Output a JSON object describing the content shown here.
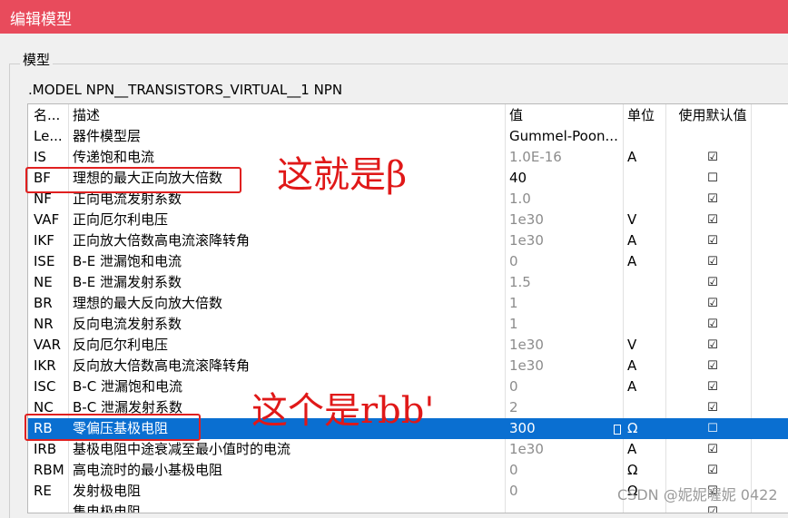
{
  "window": {
    "title": "编辑模型"
  },
  "group": {
    "label": "模型"
  },
  "model_line": ".MODEL NPN__TRANSISTORS_VIRTUAL__1 NPN",
  "table": {
    "headers": {
      "name": "名...",
      "desc": "描述",
      "value": "值",
      "unit": "单位",
      "default": "使用默认值"
    },
    "rows": [
      {
        "name": "Le...",
        "desc": "器件模型层",
        "value": "Gummel-Poon...",
        "unit": "",
        "default": "",
        "value_style": "black"
      },
      {
        "name": "IS",
        "desc": "传递饱和电流",
        "value": "1.0E-16",
        "unit": "A",
        "default": "☑",
        "value_style": "gray"
      },
      {
        "name": "BF",
        "desc": "理想的最大正向放大倍数",
        "value": "40",
        "unit": "",
        "default": "☐",
        "value_style": "black"
      },
      {
        "name": "NF",
        "desc": "正向电流发射系数",
        "value": "1.0",
        "unit": "",
        "default": "☑",
        "value_style": "gray"
      },
      {
        "name": "VAF",
        "desc": "正向厄尔利电压",
        "value": "1e30",
        "unit": "V",
        "default": "☑",
        "value_style": "gray"
      },
      {
        "name": "IKF",
        "desc": "正向放大倍数高电流滚降转角",
        "value": "1e30",
        "unit": "A",
        "default": "☑",
        "value_style": "gray"
      },
      {
        "name": "ISE",
        "desc": "B-E 泄漏饱和电流",
        "value": "0",
        "unit": "A",
        "default": "☑",
        "value_style": "gray"
      },
      {
        "name": "NE",
        "desc": "B-E 泄漏发射系数",
        "value": "1.5",
        "unit": "",
        "default": "☑",
        "value_style": "gray"
      },
      {
        "name": "BR",
        "desc": "理想的最大反向放大倍数",
        "value": "1",
        "unit": "",
        "default": "☑",
        "value_style": "gray"
      },
      {
        "name": "NR",
        "desc": "反向电流发射系数",
        "value": "1",
        "unit": "",
        "default": "☑",
        "value_style": "gray"
      },
      {
        "name": "VAR",
        "desc": "反向厄尔利电压",
        "value": "1e30",
        "unit": "V",
        "default": "☑",
        "value_style": "gray"
      },
      {
        "name": "IKR",
        "desc": "反向放大倍数高电流滚降转角",
        "value": "1e30",
        "unit": "A",
        "default": "☑",
        "value_style": "gray"
      },
      {
        "name": "ISC",
        "desc": "B-C 泄漏饱和电流",
        "value": "0",
        "unit": "A",
        "default": "☑",
        "value_style": "gray"
      },
      {
        "name": "NC",
        "desc": "B-C 泄漏发射系数",
        "value": "2",
        "unit": "",
        "default": "☑",
        "value_style": "gray"
      },
      {
        "name": "RB",
        "desc": "零偏压基极电阻",
        "value": "300",
        "unit": "Ω",
        "default": "☐",
        "value_style": "black",
        "selected": true
      },
      {
        "name": "IRB",
        "desc": "基极电阻中途衰减至最小值时的电流",
        "value": "1e30",
        "unit": "A",
        "default": "☑",
        "value_style": "gray"
      },
      {
        "name": "RBM",
        "desc": "高电流时的最小基极电阻",
        "value": "0",
        "unit": "Ω",
        "default": "☑",
        "value_style": "gray"
      },
      {
        "name": "RE",
        "desc": "发射极电阻",
        "value": "0",
        "unit": "Ω",
        "default": "☑",
        "value_style": "gray"
      },
      {
        "name": "",
        "desc": "集电极电阻",
        "value": "",
        "unit": "",
        "default": "☑",
        "value_style": "gray"
      }
    ]
  },
  "annotations": {
    "beta": "这就是β",
    "rbb": "这个是rbb'"
  },
  "watermark": "CSDN @妮妮喔妮 0422",
  "colors": {
    "titlebar": "#e84b5c",
    "selection": "#0a6fd1",
    "annotation": "#e01818"
  }
}
